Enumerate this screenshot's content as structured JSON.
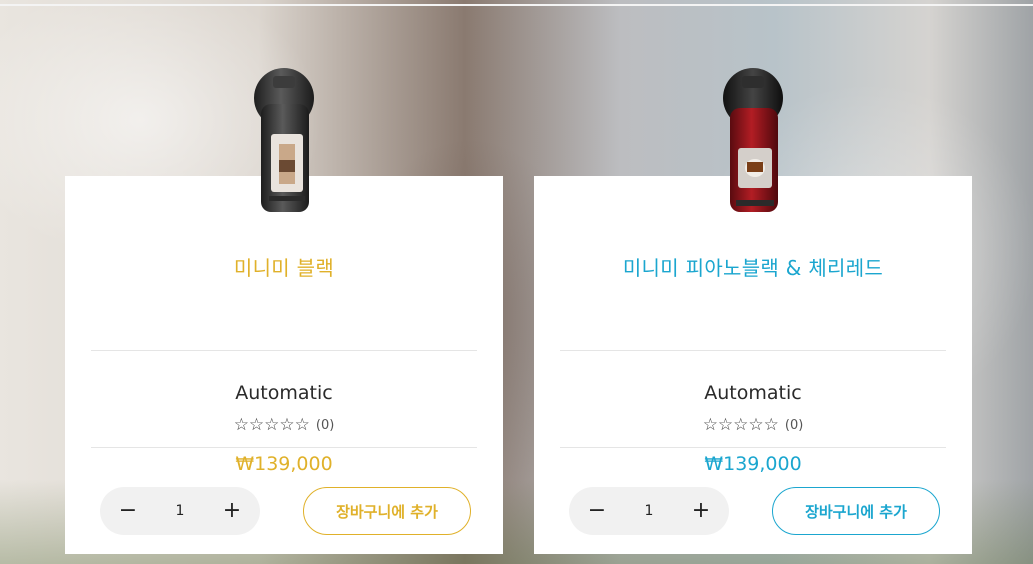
{
  "accents": {
    "gold": "#e0b12a",
    "teal": "#1ba6cf"
  },
  "products": [
    {
      "name": "미니미 블랙",
      "type": "Automatic",
      "stars": "☆☆☆☆☆",
      "rating_count": "(0)",
      "price": "₩139,000",
      "quantity": "1",
      "minus": "−",
      "plus": "+",
      "cart_label": "장바구니에 추가",
      "image_icon": "coffee-machine-black-icon"
    },
    {
      "name": "미니미 피아노블랙 & 체리레드",
      "type": "Automatic",
      "stars": "☆☆☆☆☆",
      "rating_count": "(0)",
      "price": "₩139,000",
      "quantity": "1",
      "minus": "−",
      "plus": "+",
      "cart_label": "장바구니에 추가",
      "image_icon": "coffee-machine-red-icon"
    }
  ]
}
